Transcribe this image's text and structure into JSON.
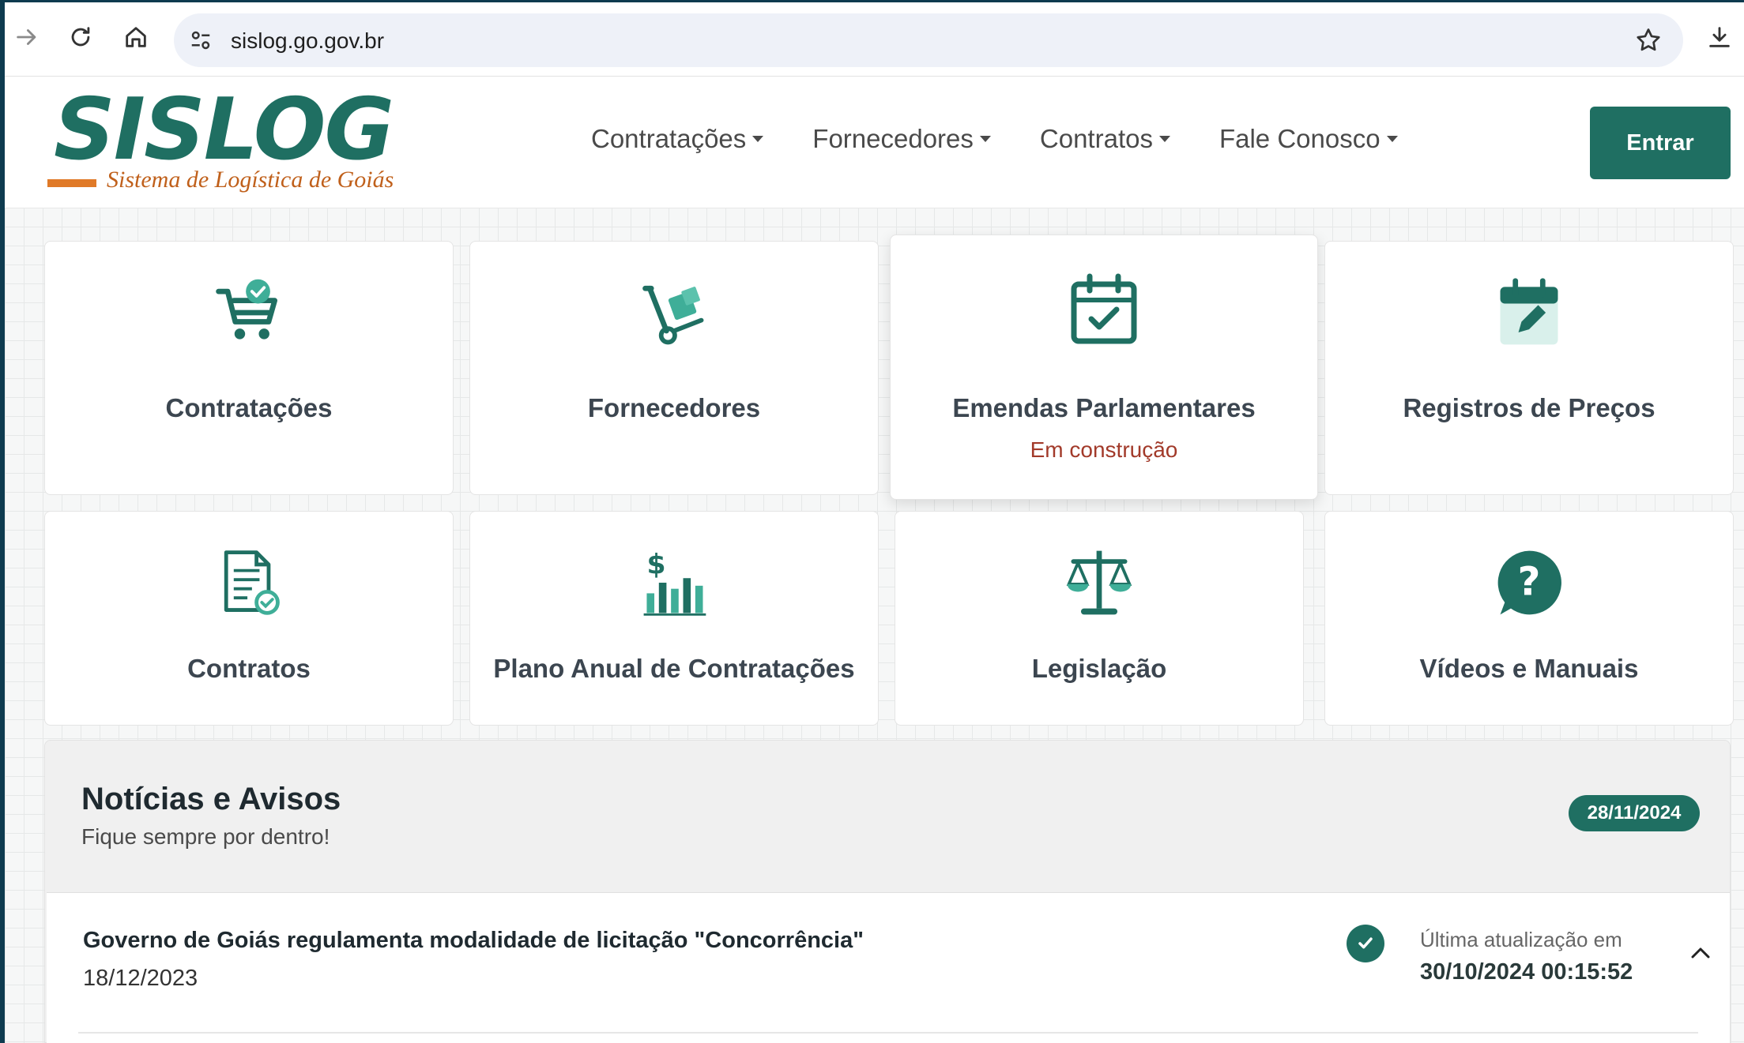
{
  "browser": {
    "url": "sislog.go.gov.br"
  },
  "header": {
    "logo_text": "SISLOG",
    "logo_subtitle": "Sistema de Logística de Goiás",
    "nav": [
      {
        "label": "Contratações"
      },
      {
        "label": "Fornecedores"
      },
      {
        "label": "Contratos"
      },
      {
        "label": "Fale Conosco"
      }
    ],
    "login_label": "Entrar"
  },
  "cards": [
    {
      "label": "Contratações",
      "icon": "cart-check-icon"
    },
    {
      "label": "Fornecedores",
      "icon": "hand-truck-icon"
    },
    {
      "label": "Emendas Parlamentares",
      "sub": "Em construção",
      "icon": "calendar-check-icon"
    },
    {
      "label": "Registros de Preços",
      "icon": "calendar-edit-icon"
    },
    {
      "label": "Contratos",
      "icon": "document-check-icon"
    },
    {
      "label": "Plano Anual de Contratações",
      "icon": "dollar-chart-icon"
    },
    {
      "label": "Legislação",
      "icon": "scales-icon"
    },
    {
      "label": "Vídeos e Manuais",
      "icon": "question-bubble-icon"
    }
  ],
  "news": {
    "title": "Notícias e Avisos",
    "subtitle": "Fique sempre por dentro!",
    "date_badge": "28/11/2024",
    "items": [
      {
        "title": "Governo de Goiás regulamenta modalidade de licitação \"Concorrência\"",
        "date": "18/12/2023",
        "updated_label": "Última atualização em",
        "updated_value": "30/10/2024 00:15:52"
      }
    ]
  },
  "colors": {
    "brand_green": "#1f6f62",
    "accent_orange": "#e07a28",
    "warning_red": "#a23a2a"
  }
}
